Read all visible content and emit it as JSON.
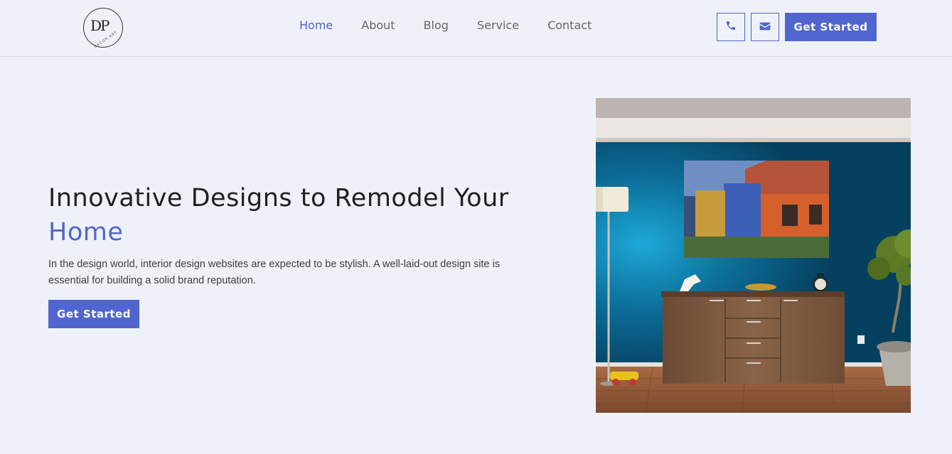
{
  "brand": {
    "logo_mark": "DP",
    "logo_sub": "DECOR ART"
  },
  "nav": {
    "items": [
      {
        "label": "Home",
        "active": true
      },
      {
        "label": "About",
        "active": false
      },
      {
        "label": "Blog",
        "active": false
      },
      {
        "label": "Service",
        "active": false
      },
      {
        "label": "Contact",
        "active": false
      }
    ]
  },
  "header": {
    "phone_icon": "phone-icon",
    "mail_icon": "envelope-icon",
    "cta_label": "Get Started"
  },
  "hero": {
    "title": "Innovative Designs to Remodel Your",
    "title_accent": "Home",
    "text": "In the design world, interior design websites are expected to be stylish. A well-laid-out design site is essential for building a solid brand reputation.",
    "cta_label": "Get Started"
  },
  "colors": {
    "accent": "#5165cf",
    "background": "#eef2f8",
    "heading": "#1f1f24"
  }
}
